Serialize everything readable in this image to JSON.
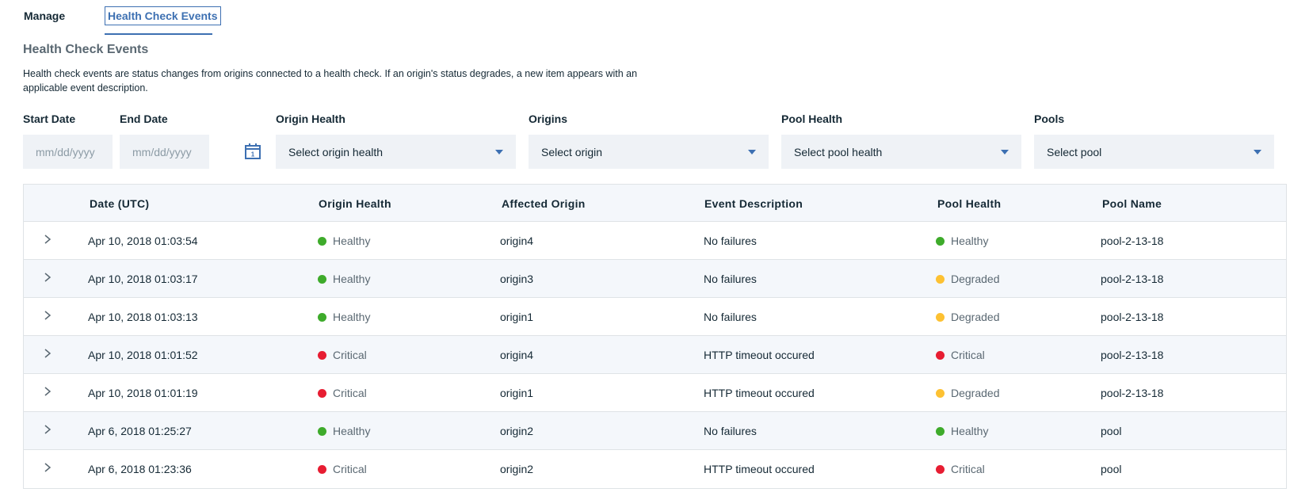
{
  "tabs": [
    {
      "label": "Manage"
    },
    {
      "label": "Health Check Events"
    }
  ],
  "section": {
    "title": "Health Check Events",
    "description": "Health check events are status changes from origins connected to a health check. If an origin's status degrades, a new item appears with an applicable event description."
  },
  "filters": {
    "start_date": {
      "label": "Start Date",
      "placeholder": "mm/dd/yyyy"
    },
    "end_date": {
      "label": "End Date",
      "placeholder": "mm/dd/yyyy"
    },
    "calendar_icon": "calendar-icon",
    "origin_health": {
      "label": "Origin Health",
      "value": "Select origin health"
    },
    "origins": {
      "label": "Origins",
      "value": "Select origin"
    },
    "pool_health": {
      "label": "Pool Health",
      "value": "Select pool health"
    },
    "pools": {
      "label": "Pools",
      "value": "Select pool"
    }
  },
  "table": {
    "columns": [
      "Date (UTC)",
      "Origin Health",
      "Affected Origin",
      "Event Description",
      "Pool Health",
      "Pool Name"
    ],
    "rows": [
      {
        "date": "Apr 10, 2018 01:03:54",
        "origin_health": "Healthy",
        "origin": "origin4",
        "description": "No failures",
        "pool_health": "Healthy",
        "pool": "pool-2-13-18"
      },
      {
        "date": "Apr 10, 2018 01:03:17",
        "origin_health": "Healthy",
        "origin": "origin3",
        "description": "No failures",
        "pool_health": "Degraded",
        "pool": "pool-2-13-18"
      },
      {
        "date": "Apr 10, 2018 01:03:13",
        "origin_health": "Healthy",
        "origin": "origin1",
        "description": "No failures",
        "pool_health": "Degraded",
        "pool": "pool-2-13-18"
      },
      {
        "date": "Apr 10, 2018 01:01:52",
        "origin_health": "Critical",
        "origin": "origin4",
        "description": "HTTP timeout occured",
        "pool_health": "Critical",
        "pool": "pool-2-13-18"
      },
      {
        "date": "Apr 10, 2018 01:01:19",
        "origin_health": "Critical",
        "origin": "origin1",
        "description": "HTTP timeout occured",
        "pool_health": "Degraded",
        "pool": "pool-2-13-18"
      },
      {
        "date": "Apr 6, 2018 01:25:27",
        "origin_health": "Healthy",
        "origin": "origin2",
        "description": "No failures",
        "pool_health": "Healthy",
        "pool": "pool"
      },
      {
        "date": "Apr 6, 2018 01:23:36",
        "origin_health": "Critical",
        "origin": "origin2",
        "description": "HTTP timeout occured",
        "pool_health": "Critical",
        "pool": "pool"
      }
    ]
  },
  "status_colors": {
    "Healthy": "#3eab2b",
    "Degraded": "#fdc132",
    "Critical": "#e71d32"
  },
  "accent_color": "#3d70b2"
}
